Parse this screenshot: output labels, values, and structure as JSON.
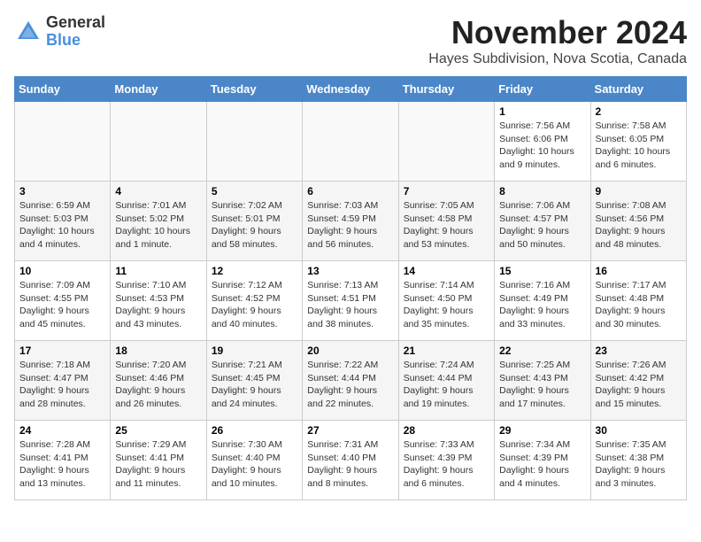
{
  "header": {
    "logo_line1": "General",
    "logo_line2": "Blue",
    "month": "November 2024",
    "location": "Hayes Subdivision, Nova Scotia, Canada"
  },
  "weekdays": [
    "Sunday",
    "Monday",
    "Tuesday",
    "Wednesday",
    "Thursday",
    "Friday",
    "Saturday"
  ],
  "weeks": [
    [
      {
        "day": "",
        "info": ""
      },
      {
        "day": "",
        "info": ""
      },
      {
        "day": "",
        "info": ""
      },
      {
        "day": "",
        "info": ""
      },
      {
        "day": "",
        "info": ""
      },
      {
        "day": "1",
        "info": "Sunrise: 7:56 AM\nSunset: 6:06 PM\nDaylight: 10 hours and 9 minutes."
      },
      {
        "day": "2",
        "info": "Sunrise: 7:58 AM\nSunset: 6:05 PM\nDaylight: 10 hours and 6 minutes."
      }
    ],
    [
      {
        "day": "3",
        "info": "Sunrise: 6:59 AM\nSunset: 5:03 PM\nDaylight: 10 hours and 4 minutes."
      },
      {
        "day": "4",
        "info": "Sunrise: 7:01 AM\nSunset: 5:02 PM\nDaylight: 10 hours and 1 minute."
      },
      {
        "day": "5",
        "info": "Sunrise: 7:02 AM\nSunset: 5:01 PM\nDaylight: 9 hours and 58 minutes."
      },
      {
        "day": "6",
        "info": "Sunrise: 7:03 AM\nSunset: 4:59 PM\nDaylight: 9 hours and 56 minutes."
      },
      {
        "day": "7",
        "info": "Sunrise: 7:05 AM\nSunset: 4:58 PM\nDaylight: 9 hours and 53 minutes."
      },
      {
        "day": "8",
        "info": "Sunrise: 7:06 AM\nSunset: 4:57 PM\nDaylight: 9 hours and 50 minutes."
      },
      {
        "day": "9",
        "info": "Sunrise: 7:08 AM\nSunset: 4:56 PM\nDaylight: 9 hours and 48 minutes."
      }
    ],
    [
      {
        "day": "10",
        "info": "Sunrise: 7:09 AM\nSunset: 4:55 PM\nDaylight: 9 hours and 45 minutes."
      },
      {
        "day": "11",
        "info": "Sunrise: 7:10 AM\nSunset: 4:53 PM\nDaylight: 9 hours and 43 minutes."
      },
      {
        "day": "12",
        "info": "Sunrise: 7:12 AM\nSunset: 4:52 PM\nDaylight: 9 hours and 40 minutes."
      },
      {
        "day": "13",
        "info": "Sunrise: 7:13 AM\nSunset: 4:51 PM\nDaylight: 9 hours and 38 minutes."
      },
      {
        "day": "14",
        "info": "Sunrise: 7:14 AM\nSunset: 4:50 PM\nDaylight: 9 hours and 35 minutes."
      },
      {
        "day": "15",
        "info": "Sunrise: 7:16 AM\nSunset: 4:49 PM\nDaylight: 9 hours and 33 minutes."
      },
      {
        "day": "16",
        "info": "Sunrise: 7:17 AM\nSunset: 4:48 PM\nDaylight: 9 hours and 30 minutes."
      }
    ],
    [
      {
        "day": "17",
        "info": "Sunrise: 7:18 AM\nSunset: 4:47 PM\nDaylight: 9 hours and 28 minutes."
      },
      {
        "day": "18",
        "info": "Sunrise: 7:20 AM\nSunset: 4:46 PM\nDaylight: 9 hours and 26 minutes."
      },
      {
        "day": "19",
        "info": "Sunrise: 7:21 AM\nSunset: 4:45 PM\nDaylight: 9 hours and 24 minutes."
      },
      {
        "day": "20",
        "info": "Sunrise: 7:22 AM\nSunset: 4:44 PM\nDaylight: 9 hours and 22 minutes."
      },
      {
        "day": "21",
        "info": "Sunrise: 7:24 AM\nSunset: 4:44 PM\nDaylight: 9 hours and 19 minutes."
      },
      {
        "day": "22",
        "info": "Sunrise: 7:25 AM\nSunset: 4:43 PM\nDaylight: 9 hours and 17 minutes."
      },
      {
        "day": "23",
        "info": "Sunrise: 7:26 AM\nSunset: 4:42 PM\nDaylight: 9 hours and 15 minutes."
      }
    ],
    [
      {
        "day": "24",
        "info": "Sunrise: 7:28 AM\nSunset: 4:41 PM\nDaylight: 9 hours and 13 minutes."
      },
      {
        "day": "25",
        "info": "Sunrise: 7:29 AM\nSunset: 4:41 PM\nDaylight: 9 hours and 11 minutes."
      },
      {
        "day": "26",
        "info": "Sunrise: 7:30 AM\nSunset: 4:40 PM\nDaylight: 9 hours and 10 minutes."
      },
      {
        "day": "27",
        "info": "Sunrise: 7:31 AM\nSunset: 4:40 PM\nDaylight: 9 hours and 8 minutes."
      },
      {
        "day": "28",
        "info": "Sunrise: 7:33 AM\nSunset: 4:39 PM\nDaylight: 9 hours and 6 minutes."
      },
      {
        "day": "29",
        "info": "Sunrise: 7:34 AM\nSunset: 4:39 PM\nDaylight: 9 hours and 4 minutes."
      },
      {
        "day": "30",
        "info": "Sunrise: 7:35 AM\nSunset: 4:38 PM\nDaylight: 9 hours and 3 minutes."
      }
    ]
  ]
}
